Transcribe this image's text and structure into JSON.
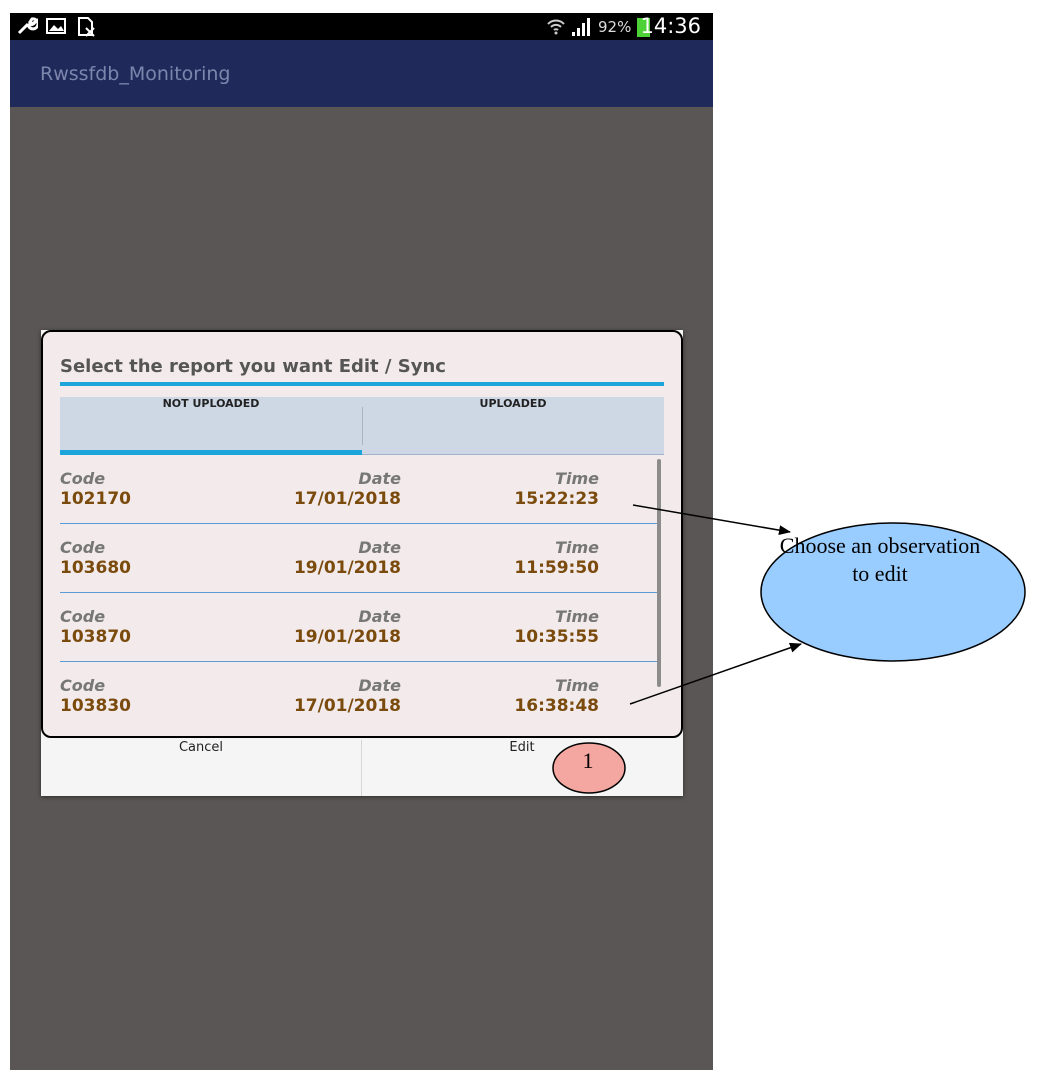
{
  "statusbar": {
    "battery_percent": "92%",
    "clock": "14:36",
    "icons": [
      "wrench-icon",
      "image-icon",
      "sim-off-icon",
      "wifi-icon",
      "signal-icon",
      "battery-icon"
    ]
  },
  "app": {
    "title": "Rwssfdb_Monitoring"
  },
  "dialog": {
    "title": "Select the report you want Edit / Sync",
    "tabs": [
      {
        "label": "NOT UPLOADED",
        "selected": true
      },
      {
        "label": "UPLOADED",
        "selected": false
      }
    ],
    "rows": [
      {
        "code_label": "Code",
        "code": "102170",
        "date_label": "Date",
        "date": "17/01/2018",
        "time_label": "Time",
        "time": "15:22:23"
      },
      {
        "code_label": "Code",
        "code": "103680",
        "date_label": "Date",
        "date": "19/01/2018",
        "time_label": "Time",
        "time": "11:59:50"
      },
      {
        "code_label": "Code",
        "code": "103870",
        "date_label": "Date",
        "date": "19/01/2018",
        "time_label": "Time",
        "time": "10:35:55"
      },
      {
        "code_label": "Code",
        "code": "103830",
        "date_label": "Date",
        "date": "17/01/2018",
        "time_label": "Time",
        "time": "16:38:48"
      }
    ],
    "cancel_label": "Cancel",
    "edit_label": "Edit"
  },
  "annotations": {
    "callout_text": "Choose an observation to edit",
    "marker_label": "1",
    "callout_fill": "#99ccff",
    "marker_fill": "#f4a6a0"
  }
}
